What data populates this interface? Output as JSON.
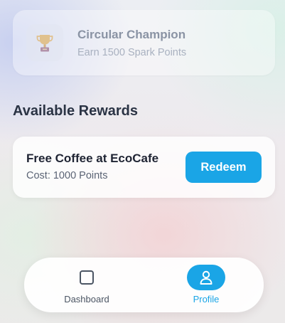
{
  "achievement": {
    "title": "Circular Champion",
    "subtitle": "Earn 1500 Spark Points",
    "icon": "trophy-icon",
    "state": "locked"
  },
  "rewards_section": {
    "title": "Available Rewards"
  },
  "rewards": [
    {
      "title": "Free Coffee at EcoCafe",
      "cost": "Cost: 1000 Points",
      "action_label": "Redeem"
    }
  ],
  "bottom_nav": {
    "items": [
      {
        "label": "Dashboard",
        "icon": "square-icon",
        "active": false
      },
      {
        "label": "Profile",
        "icon": "user-icon",
        "active": true
      }
    ]
  },
  "colors": {
    "accent": "#1aa5e6",
    "heading": "#2a3344",
    "muted": "#8a93a4"
  }
}
